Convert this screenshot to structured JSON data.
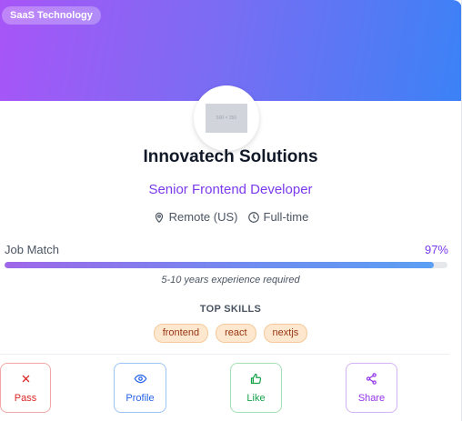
{
  "banner": {
    "tag": "SaaS Technology"
  },
  "logo": {
    "placeholder_text": "500 × 350"
  },
  "company": {
    "name": "Innovatech Solutions"
  },
  "job": {
    "title": "Senior Frontend Developer",
    "location": "Remote (US)",
    "type": "Full-time",
    "experience": "5-10 years experience required"
  },
  "match": {
    "label": "Job Match",
    "value_text": "97%",
    "value": 97
  },
  "skills": {
    "title": "TOP SKILLS",
    "items": [
      "frontend",
      "react",
      "nextjs"
    ]
  },
  "actions": {
    "pass": "Pass",
    "profile": "Profile",
    "like": "Like",
    "share": "Share"
  },
  "icons": {
    "location": "map-pin-icon",
    "clock": "clock-icon",
    "pass": "x-icon",
    "profile": "eye-icon",
    "like": "thumbs-up-icon",
    "share": "share-icon"
  },
  "colors": {
    "accent": "#7c3aed",
    "gradient_start": "#a855f7",
    "gradient_end": "#3b82f6"
  }
}
